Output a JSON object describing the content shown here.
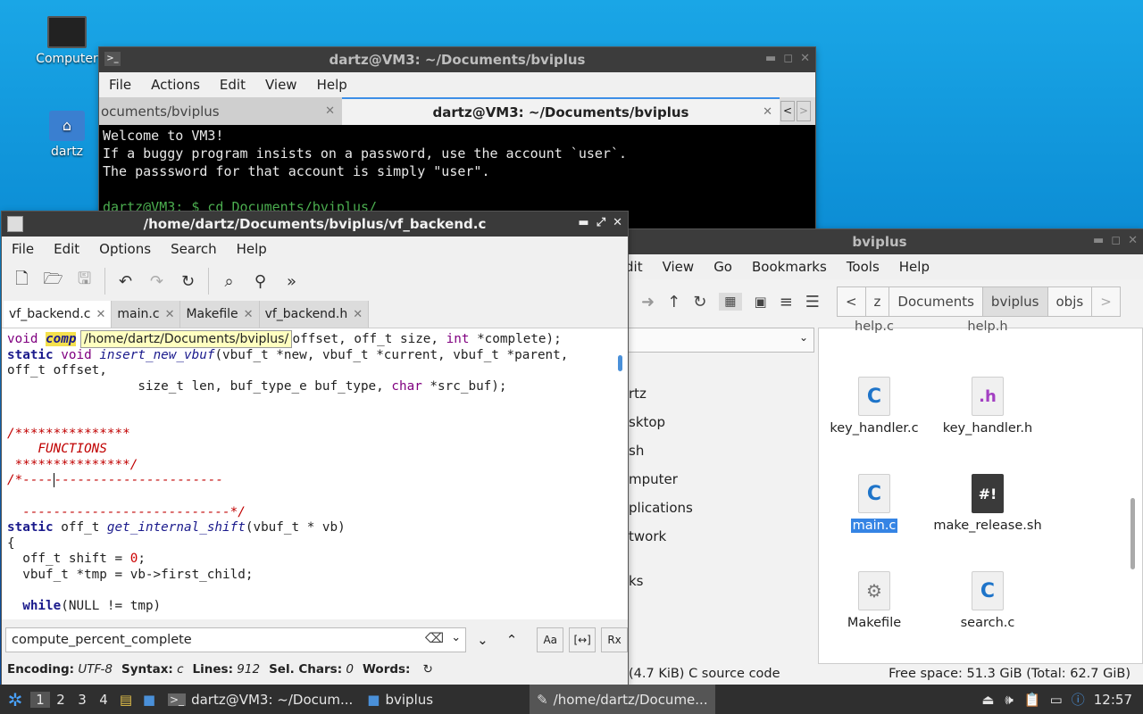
{
  "desktop": {
    "icons": [
      {
        "label": "Computer"
      },
      {
        "label": "dartz"
      }
    ]
  },
  "terminal": {
    "title": "dartz@VM3: ~/Documents/bviplus",
    "menu": [
      "File",
      "Actions",
      "Edit",
      "View",
      "Help"
    ],
    "tabs": [
      "ocuments/bviplus",
      "dartz@VM3: ~/Documents/bviplus"
    ],
    "lines": [
      "Welcome to VM3!",
      "If a buggy program insists on a password, use the account `user`.",
      "The passsword for that account is simply \"user\".",
      "",
      "dartz@VM3: $ cd Documents/bviplus/"
    ]
  },
  "editor": {
    "title": "/home/dartz/Documents/bviplus/vf_backend.c",
    "menu": [
      "File",
      "Edit",
      "Options",
      "Search",
      "Help"
    ],
    "tabs": [
      "vf_backend.c",
      "main.c",
      "Makefile",
      "vf_backend.h"
    ],
    "tooltip": "/home/dartz/Documents/bviplus/",
    "code": {
      "l1a": "void ",
      "l1b": "comp",
      "l1c": "offset, off_t size, ",
      "l1d": "int",
      "l1e": " *complete);",
      "l2a": "static",
      "l2b": " void ",
      "l2c": "insert_new_vbuf",
      "l2d": "(vbuf_t *new, vbuf_t *current, vbuf_t *parent,",
      "l3": "off_t offset,",
      "l4a": "                 size_t len, buf_type_e buf_type, ",
      "l4b": "char",
      "l4c": " *src_buf);",
      "c1": "/***************",
      "c2": "    FUNCTIONS",
      "c3": " ***************/",
      "c4a": "/*----",
      "c4b": "----------------------",
      "c5": "  ---------------------------*/",
      "f1a": "static",
      "f1b": " off_t ",
      "f1c": "get_internal_shift",
      "f1d": "(vbuf_t * vb)",
      "f2": "{",
      "f3a": "  off_t shift = ",
      "f3b": "0",
      "f3c": ";",
      "f4": "  vbuf_t *tmp = vb->first_child;",
      "f6a": "  while",
      "f6b": "(NULL != tmp)"
    },
    "search_value": "compute_percent_complete",
    "status": {
      "encoding_label": "Encoding:",
      "encoding": "UTF-8",
      "syntax_label": "Syntax:",
      "syntax": "c",
      "lines_label": "Lines:",
      "lines": "912",
      "sel_label": "Sel. Chars:",
      "sel": "0",
      "words_label": "Words:"
    }
  },
  "filemanager": {
    "title": "bviplus",
    "menu": [
      "dit",
      "View",
      "Go",
      "Bookmarks",
      "Tools",
      "Help"
    ],
    "breadcrumbs": [
      "z",
      "Documents",
      "bviplus",
      "objs"
    ],
    "sidebar": [
      "rtz",
      "sktop",
      "sh",
      "mputer",
      "plications",
      "twork",
      "ks"
    ],
    "files": [
      {
        "name": "help.c"
      },
      {
        "name": "help.h"
      },
      {
        "name": "key_handler.c",
        "glyph": "C"
      },
      {
        "name": "key_handler.h",
        "glyph": ".h"
      },
      {
        "name": "main.c",
        "glyph": "C"
      },
      {
        "name": "make_release.sh",
        "glyph": "#!"
      },
      {
        "name": "Makefile",
        "glyph": "⚙"
      },
      {
        "name": "search.c",
        "glyph": "C"
      }
    ],
    "status_left": "(4.7 KiB) C source code",
    "status_right": "Free space: 51.3 GiB (Total: 62.7 GiB)"
  },
  "taskbar": {
    "workspaces": [
      "1",
      "2",
      "3",
      "4"
    ],
    "tasks": [
      "dartz@VM3: ~/Docum...",
      "bviplus",
      "/home/dartz/Docume..."
    ],
    "clock": "12:57"
  },
  "colors": {
    "accent": "#3d8ee6",
    "selection": "#3584e4",
    "tooltip": "#ffffc0"
  }
}
